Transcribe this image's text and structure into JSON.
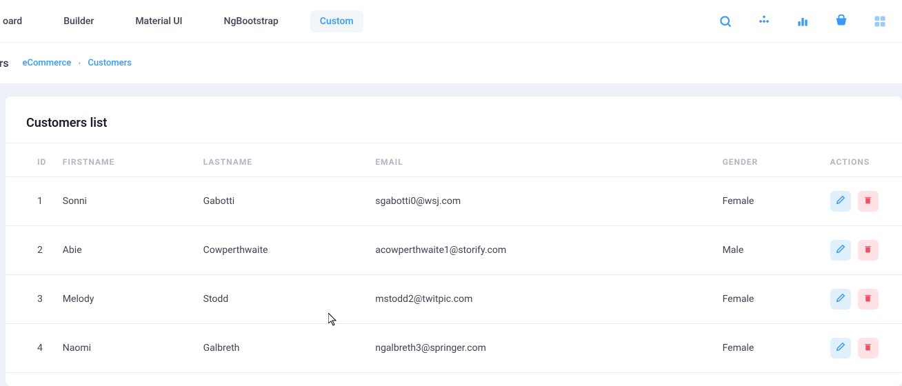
{
  "nav": {
    "tabs": [
      {
        "label": "oard"
      },
      {
        "label": "Builder"
      },
      {
        "label": "Material UI"
      },
      {
        "label": "NgBootstrap"
      },
      {
        "label": "Custom"
      }
    ],
    "activeIndex": 4
  },
  "subheader": {
    "titlePartial": "ers",
    "breadcrumb": [
      {
        "label": "eCommerce"
      },
      {
        "label": "Customers"
      }
    ]
  },
  "card": {
    "title": "Customers list"
  },
  "table": {
    "columns": [
      "ID",
      "FIRSTNAME",
      "LASTNAME",
      "EMAIL",
      "GENDER",
      "ACTIONS"
    ],
    "rows": [
      {
        "id": "1",
        "first": "Sonni",
        "last": "Gabotti",
        "email": "sgabotti0@wsj.com",
        "gender": "Female"
      },
      {
        "id": "2",
        "first": "Abie",
        "last": "Cowperthwaite",
        "email": "acowperthwaite1@storify.com",
        "gender": "Male"
      },
      {
        "id": "3",
        "first": "Melody",
        "last": "Stodd",
        "email": "mstodd2@twitpic.com",
        "gender": "Female"
      },
      {
        "id": "4",
        "first": "Naomi",
        "last": "Galbreth",
        "email": "ngalbreth3@springer.com",
        "gender": "Female"
      }
    ]
  },
  "colors": {
    "primary": "#3699ff",
    "danger": "#f64e60",
    "muted": "#b5b5c3"
  }
}
